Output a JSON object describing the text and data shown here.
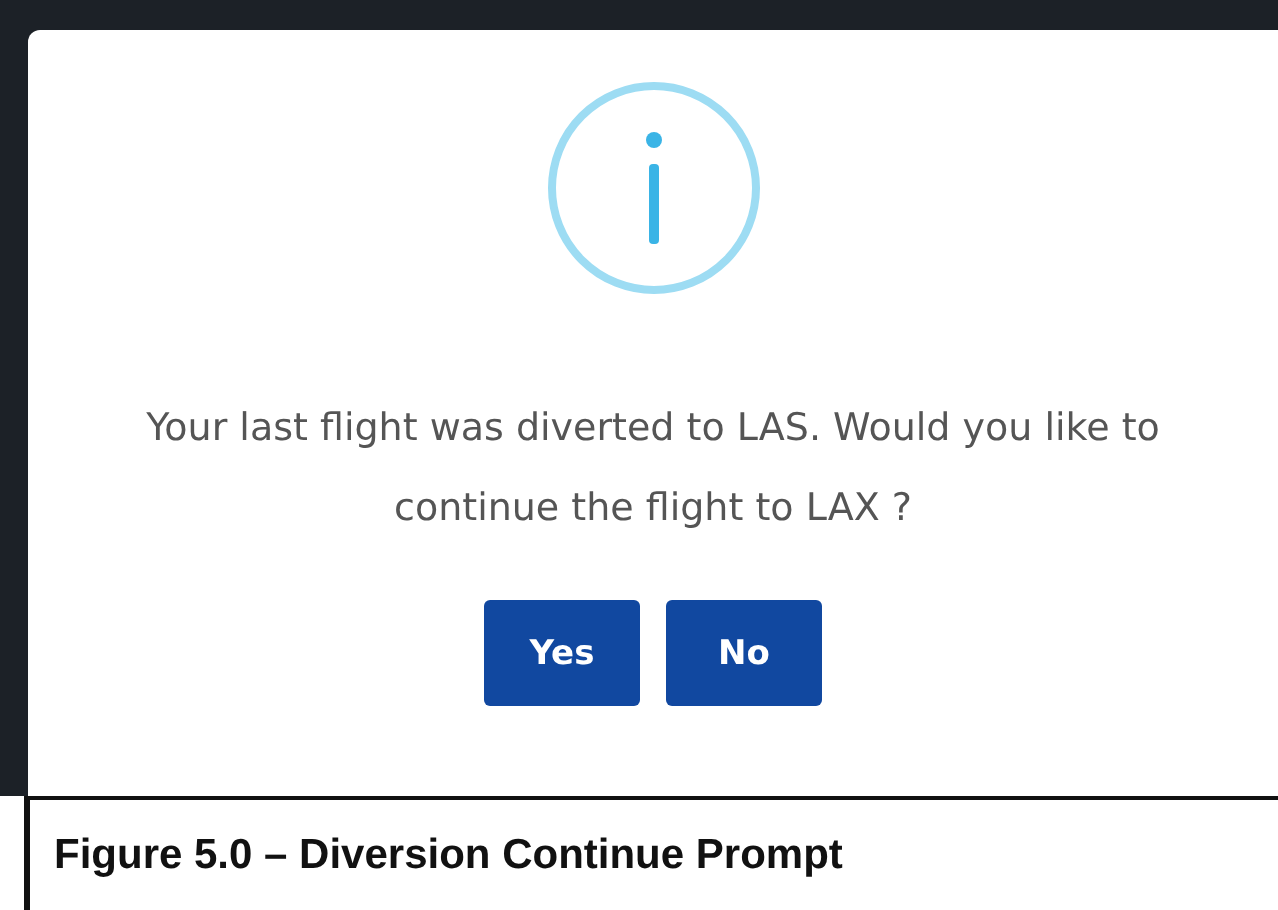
{
  "dialog": {
    "message": "Your last flight was diverted to LAS. Would you like to continue the flight to LAX ?",
    "buttons": [
      {
        "label": "Yes"
      },
      {
        "label": "No"
      }
    ]
  },
  "caption": "Figure 5.0 – Diversion Continue Prompt"
}
